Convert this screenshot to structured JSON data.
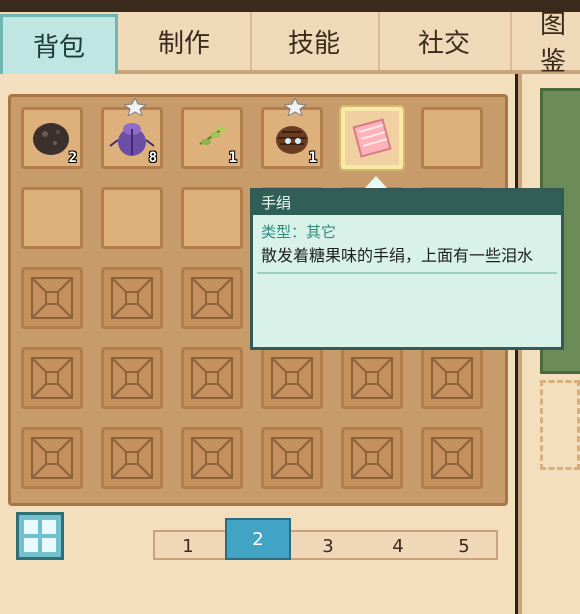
{
  "tabs": [
    "背包",
    "制作",
    "技能",
    "社交",
    "图鉴"
  ],
  "active_tab": "背包",
  "inventory": {
    "rows": [
      [
        {
          "item": "stone-icon",
          "count": "2"
        },
        {
          "item": "beetle-icon",
          "count": "8",
          "pinned": true
        },
        {
          "item": "sprout-icon",
          "count": "1"
        },
        {
          "item": "pinecone-bug-icon",
          "count": "1",
          "pinned": true
        },
        {
          "item": "handkerchief-icon",
          "count": "",
          "selected": true
        },
        {
          "item": "",
          "count": ""
        }
      ],
      [
        "",
        "",
        "",
        "",
        "",
        ""
      ],
      [
        "locked",
        "locked",
        "locked",
        "locked",
        "locked",
        "locked"
      ],
      [
        "locked",
        "locked",
        "locked",
        "locked",
        "locked",
        "locked"
      ],
      [
        "locked",
        "locked",
        "locked",
        "locked",
        "locked",
        "locked"
      ]
    ]
  },
  "tooltip": {
    "title": "手绢",
    "type": "类型：其它",
    "description": "散发着糖果味的手绢，上面有一些泪水"
  },
  "pager": {
    "pages": [
      "1",
      "2",
      "3",
      "4",
      "5"
    ],
    "active": "2"
  },
  "colors": {
    "accent": "#41a4c4",
    "tab_active": "#bfe6e2",
    "tooltip_header": "#2f5f57",
    "tooltip_type_text": "#2f8b80"
  }
}
